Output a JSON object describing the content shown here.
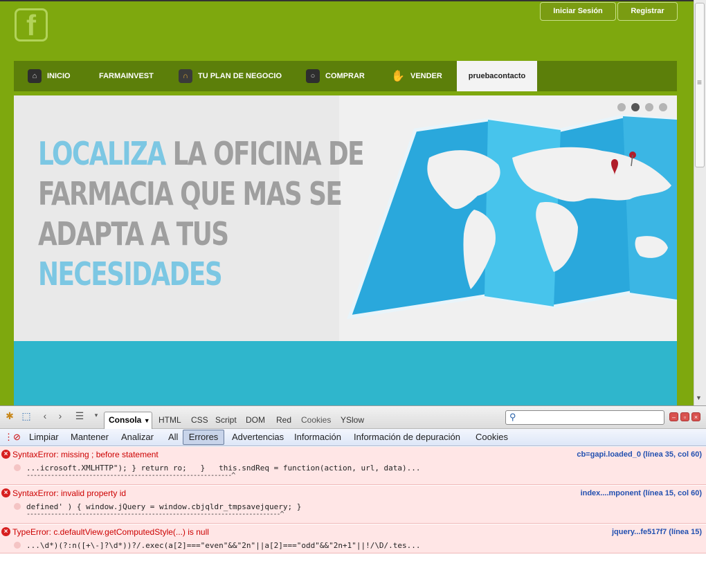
{
  "site": {
    "login_label": "Iniciar Sesión",
    "register_label": "Registrar",
    "nav": [
      "INICIO",
      "FARMAINVEST",
      "TU PLAN DE NEGOCIO",
      "COMPRAR",
      "VENDER",
      "pruebacontacto"
    ],
    "nav_active_index": 5,
    "slider": {
      "line1_highlight": "LOCALIZA",
      "line1_rest": " LA OFICINA DE",
      "line2": "FARMACIA QUE MAS SE",
      "line3": "ADAPTA A TUS",
      "line4_highlight": "NECESIDADES",
      "dots": 4,
      "active_dot": 1
    },
    "colors": {
      "brand_green": "#7ea80e",
      "nav_green": "#5c7f0a",
      "accent_blue": "#7cc7e3",
      "teal": "#2fb6cc"
    }
  },
  "firebug": {
    "console_tab": "Consola",
    "panel_tabs": [
      "HTML",
      "CSS",
      "Script",
      "DOM",
      "Red",
      "Cookies",
      "YSlow"
    ],
    "filters": [
      "Limpiar",
      "Mantener",
      "Analizar",
      "All",
      "Errores",
      "Advertencias",
      "Información",
      "Información de depuración",
      "Cookies"
    ],
    "selected_filter": "Errores",
    "errors": [
      {
        "message": "SyntaxError: missing ; before statement",
        "source": "cb=gapi.loaded_0 (línea 35, col 60)",
        "code": "...icrosoft.XMLHTTP\"); } return ro;   }   this.sndReq = function(action, url, data)...",
        "caret": "-----------------------------------------------------------^"
      },
      {
        "message": "SyntaxError: invalid property id",
        "source": "index....mponent (línea 15, col 60)",
        "code": "defined' ) { window.jQuery = window.cbjqldr_tmpsavejquery; }",
        "caret": "-------------------------------------------------------------------------^"
      },
      {
        "message": "TypeError: c.defaultView.getComputedStyle(...) is null",
        "source": "jquery...fe517f7 (línea 15)",
        "code": "...\\d*)(?:n([+\\-]?\\d*))?/.exec(a[2]===\"even\"&&\"2n\"||a[2]===\"odd\"&&\"2n+1\"||!/\\D/.tes..."
      }
    ]
  }
}
